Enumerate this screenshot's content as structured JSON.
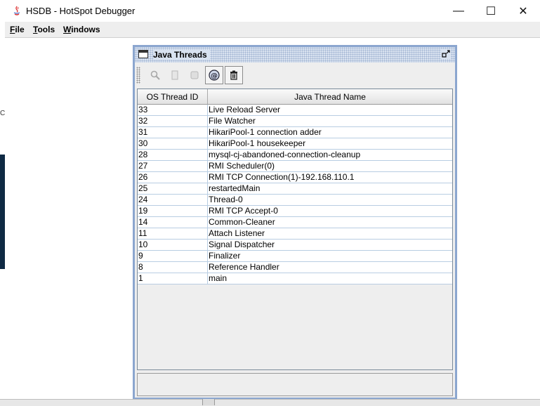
{
  "window": {
    "title": "HSDB - HotSpot Debugger",
    "controls": {
      "minimize": "—",
      "maximize": "☐",
      "close": "✕"
    }
  },
  "menubar": {
    "items": [
      {
        "underline": "F",
        "rest": "ile"
      },
      {
        "underline": "T",
        "rest": "ools"
      },
      {
        "underline": "W",
        "rest": "indows"
      }
    ]
  },
  "background_fragments": {
    "left_char": "C"
  },
  "internal_frame": {
    "title": "Java Threads",
    "toolbar": {
      "buttons": [
        {
          "icon": "magnifier-icon",
          "enabled": false
        },
        {
          "icon": "document-icon",
          "enabled": false
        },
        {
          "icon": "stack-icon",
          "enabled": false
        },
        {
          "icon": "at-icon",
          "enabled": true
        },
        {
          "icon": "trash-icon",
          "enabled": true
        }
      ]
    },
    "table": {
      "columns": [
        "OS Thread ID",
        "Java Thread Name"
      ],
      "rows": [
        [
          "33",
          "Live Reload Server"
        ],
        [
          "32",
          "File Watcher"
        ],
        [
          "31",
          "HikariPool-1 connection adder"
        ],
        [
          "30",
          "HikariPool-1 housekeeper"
        ],
        [
          "28",
          "mysql-cj-abandoned-connection-cleanup"
        ],
        [
          "27",
          "RMI Scheduler(0)"
        ],
        [
          "26",
          "RMI TCP Connection(1)-192.168.110.1"
        ],
        [
          "25",
          "restartedMain"
        ],
        [
          "24",
          "Thread-0"
        ],
        [
          "19",
          "RMI TCP Accept-0"
        ],
        [
          "14",
          "Common-Cleaner"
        ],
        [
          "11",
          "Attach Listener"
        ],
        [
          "10",
          "Signal Dispatcher"
        ],
        [
          "9",
          "Finalizer"
        ],
        [
          "8",
          "Reference Handler"
        ],
        [
          "1",
          "main"
        ]
      ]
    }
  },
  "colors": {
    "frame_border": "#8ba6cf",
    "title_fill": "#d8e2f0",
    "grid": "#b8cde2"
  }
}
